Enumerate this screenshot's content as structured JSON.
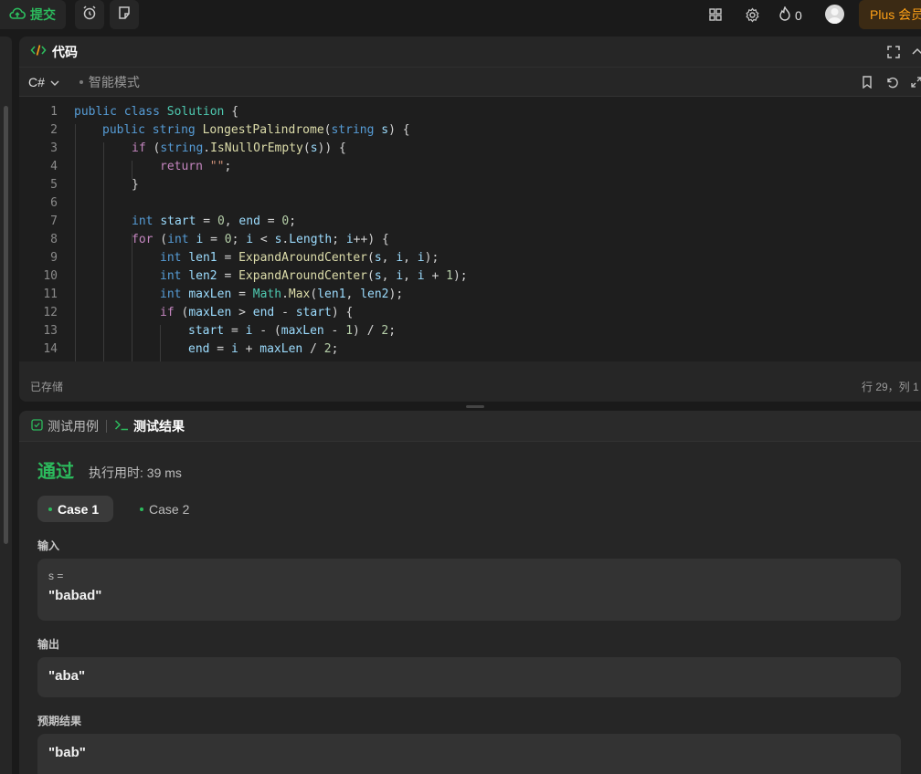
{
  "topbar": {
    "submit_label": "提交",
    "streak_count": "0",
    "plus_label": "Plus 会员"
  },
  "code_panel": {
    "title": "代码",
    "language": "C#",
    "mode": "智能模式",
    "saved_status": "已存储",
    "cursor_pos": "行 29，列 1"
  },
  "code_lines": [
    {
      "n": "1",
      "indent": 0
    },
    {
      "n": "2",
      "indent": 1
    },
    {
      "n": "3",
      "indent": 2
    },
    {
      "n": "4",
      "indent": 3
    },
    {
      "n": "5",
      "indent": 2
    },
    {
      "n": "6",
      "indent": 0
    },
    {
      "n": "7",
      "indent": 2
    },
    {
      "n": "8",
      "indent": 2
    },
    {
      "n": "9",
      "indent": 3
    },
    {
      "n": "10",
      "indent": 3
    },
    {
      "n": "11",
      "indent": 3
    },
    {
      "n": "12",
      "indent": 3
    },
    {
      "n": "13",
      "indent": 4
    },
    {
      "n": "14",
      "indent": 4
    }
  ],
  "code_text": [
    "public class Solution {",
    "public string LongestPalindrome(string s) {",
    "if (string.IsNullOrEmpty(s)) {",
    "return \"\";",
    "}",
    "",
    "int start = 0, end = 0;",
    "for (int i = 0; i < s.Length; i++) {",
    "int len1 = ExpandAroundCenter(s, i, i);",
    "int len2 = ExpandAroundCenter(s, i, i + 1);",
    "int maxLen = Math.Max(len1, len2);",
    "if (maxLen > end - start) {",
    "start = i - (maxLen - 1) / 2;",
    "end = i + maxLen / 2;"
  ],
  "result_panel": {
    "tab_testcase": "测试用例",
    "tab_result": "测试结果",
    "status": "通过",
    "runtime": "执行用时: 39 ms",
    "case1": "Case 1",
    "case2": "Case 2",
    "input_label": "输入",
    "input_var": "s =",
    "input_value": "\"babad\"",
    "output_label": "输出",
    "output_value": "\"aba\"",
    "expected_label": "预期结果",
    "expected_value": "\"bab\""
  },
  "colors": {
    "accent_green": "#2cbb5d",
    "plus_orange": "#ffa116"
  }
}
